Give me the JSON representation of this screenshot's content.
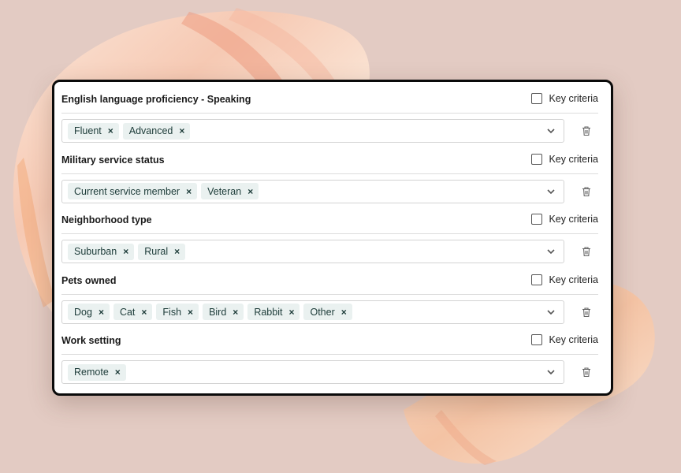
{
  "filters": [
    {
      "title": "English language proficiency - Speaking",
      "key_label": "Key criteria",
      "tags": [
        "Fluent",
        "Advanced"
      ]
    },
    {
      "title": "Military service status",
      "key_label": "Key criteria",
      "tags": [
        "Current service member",
        "Veteran"
      ]
    },
    {
      "title": "Neighborhood type",
      "key_label": "Key criteria",
      "tags": [
        "Suburban",
        "Rural"
      ]
    },
    {
      "title": "Pets owned",
      "key_label": "Key criteria",
      "tags": [
        "Dog",
        "Cat",
        "Fish",
        "Bird",
        "Rabbit",
        "Other"
      ]
    },
    {
      "title": "Work setting",
      "key_label": "Key criteria",
      "tags": [
        "Remote"
      ]
    }
  ],
  "icons": {
    "remove": "×",
    "dropdown": "chevron-down-icon",
    "delete": "trash-icon",
    "checkbox": "checkbox-unchecked"
  },
  "colors": {
    "background": "#e3cbc3",
    "chip_bg": "#eaf1f0",
    "chip_text": "#1c3b38",
    "card_border": "#0a0a0a"
  }
}
